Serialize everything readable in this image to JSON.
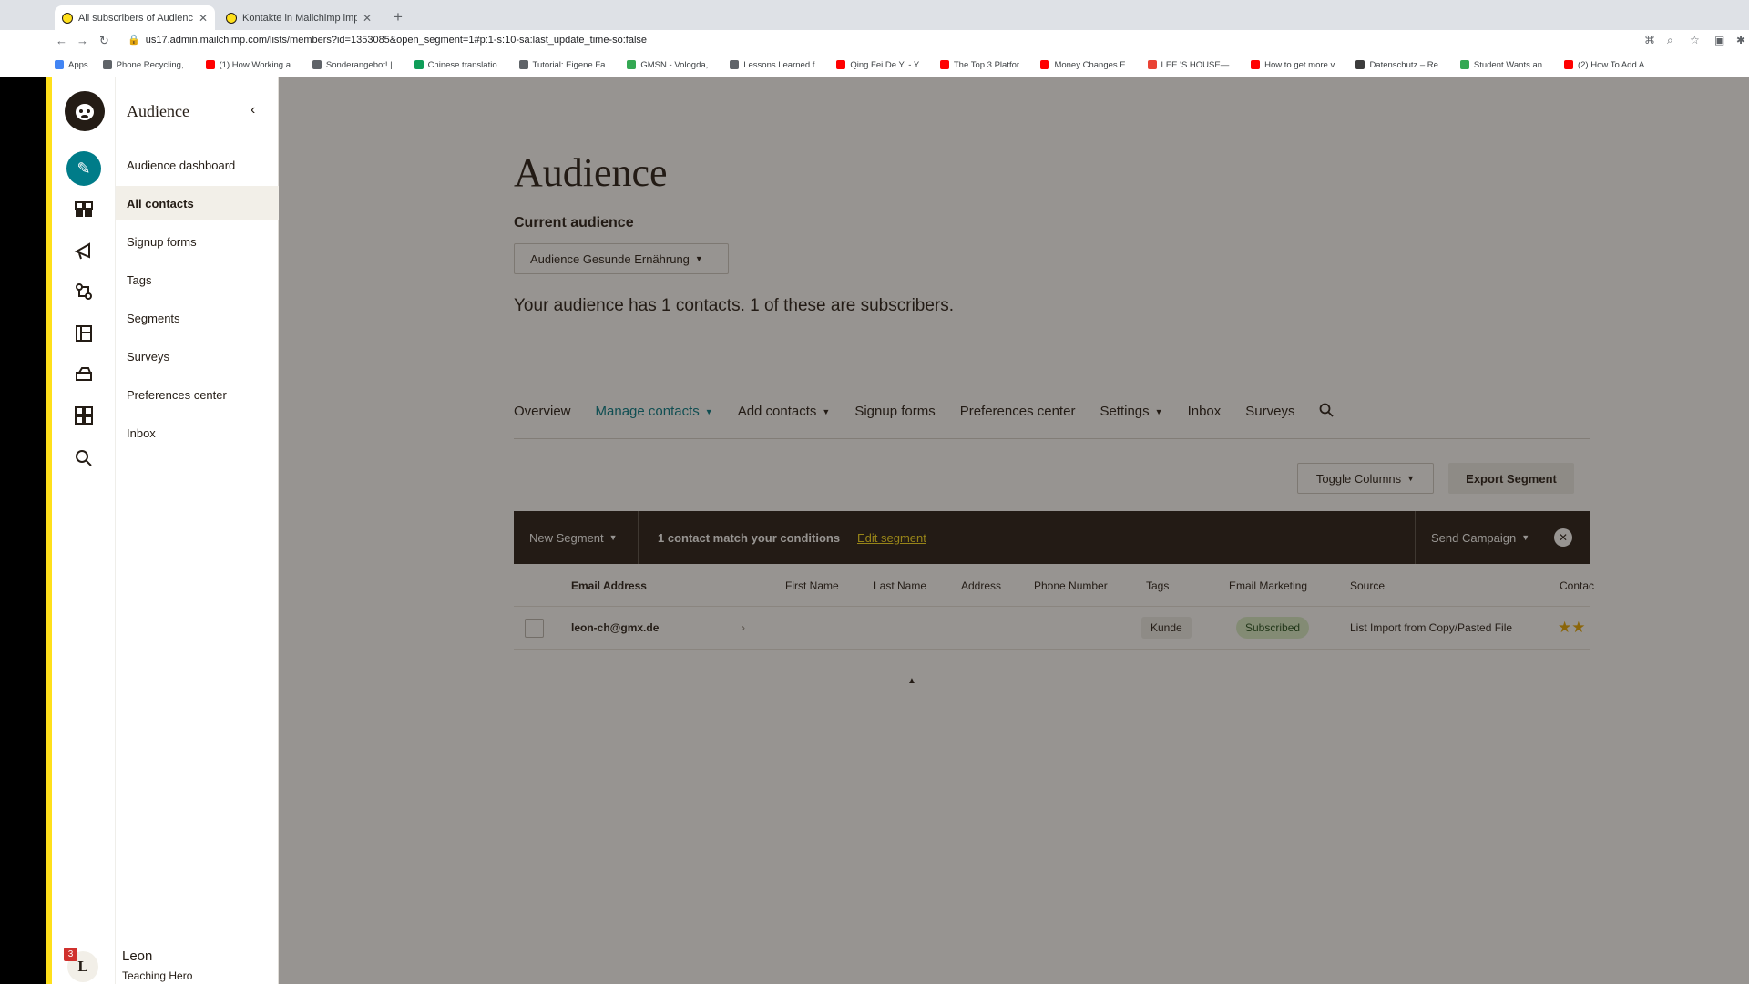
{
  "browser": {
    "tabs": [
      {
        "title": "All subscribers of Audience Ge",
        "active": true
      },
      {
        "title": "Kontakte in Mailchimp importi",
        "active": false
      }
    ],
    "new_tab": "+",
    "url": "us17.admin.mailchimp.com/lists/members?id=1353085&open_segment=1#p:1-s:10-sa:last_update_time-so:false",
    "bookmarks": [
      {
        "label": "Apps",
        "color": "#4285f4"
      },
      {
        "label": "Phone Recycling,...",
        "color": "#5f6368"
      },
      {
        "label": "(1) How Working a...",
        "color": "#ff0000"
      },
      {
        "label": "Sonderangebot! |...",
        "color": "#5f6368"
      },
      {
        "label": "Chinese translatio...",
        "color": "#0f9d58"
      },
      {
        "label": "Tutorial: Eigene Fa...",
        "color": "#5f6368"
      },
      {
        "label": "GMSN - Vologda,...",
        "color": "#34a853"
      },
      {
        "label": "Lessons Learned f...",
        "color": "#5f6368"
      },
      {
        "label": "Qing Fei De Yi - Y...",
        "color": "#ff0000"
      },
      {
        "label": "The Top 3 Platfor...",
        "color": "#ff0000"
      },
      {
        "label": "Money Changes E...",
        "color": "#ff0000"
      },
      {
        "label": "LEE 'S HOUSE—...",
        "color": "#ea4335"
      },
      {
        "label": "How to get more v...",
        "color": "#ff0000"
      },
      {
        "label": "Datenschutz – Re...",
        "color": "#3c3c3c"
      },
      {
        "label": "Student Wants an...",
        "color": "#34a853"
      },
      {
        "label": "(2) How To Add A...",
        "color": "#ff0000"
      }
    ]
  },
  "rail": {
    "icons": [
      "mailchimp-logo-icon",
      "pencil-icon",
      "contacts-icon",
      "campaigns-icon",
      "automations-icon",
      "website-icon",
      "content-icon",
      "integrations-icon",
      "search-icon"
    ],
    "notification_count": "3",
    "avatar_initial": "L"
  },
  "sidebar": {
    "title": "Audience",
    "items": [
      {
        "label": "Audience dashboard",
        "active": false
      },
      {
        "label": "All contacts",
        "active": true
      },
      {
        "label": "Signup forms",
        "active": false
      },
      {
        "label": "Tags",
        "active": false
      },
      {
        "label": "Segments",
        "active": false
      },
      {
        "label": "Surveys",
        "active": false
      },
      {
        "label": "Preferences center",
        "active": false
      },
      {
        "label": "Inbox",
        "active": false
      }
    ],
    "user_name": "Leon",
    "user_subtitle": "Teaching Hero"
  },
  "main": {
    "title": "Audience",
    "current_label": "Current audience",
    "audience_select": "Audience Gesunde Ernährung",
    "summary": "Your audience has 1 contacts. 1 of these are subscribers.",
    "tabs": [
      {
        "label": "Overview",
        "dropdown": false
      },
      {
        "label": "Manage contacts",
        "dropdown": true,
        "active": true
      },
      {
        "label": "Add contacts",
        "dropdown": true
      },
      {
        "label": "Signup forms",
        "dropdown": false
      },
      {
        "label": "Preferences center",
        "dropdown": false
      },
      {
        "label": "Settings",
        "dropdown": true
      },
      {
        "label": "Inbox",
        "dropdown": false
      },
      {
        "label": "Surveys",
        "dropdown": false
      }
    ],
    "toggle_columns": "Toggle Columns",
    "export_segment": "Export Segment",
    "segment_bar": {
      "new_segment": "New Segment",
      "match_text": "1 contact match your conditions",
      "edit_link": "Edit segment",
      "send_campaign": "Send Campaign"
    },
    "table": {
      "headers": [
        "Email Address",
        "First Name",
        "Last Name",
        "Address",
        "Phone Number",
        "Tags",
        "Email Marketing",
        "Source",
        "Contac"
      ],
      "rows": [
        {
          "email": "leon-ch@gmx.de",
          "tag": "Kunde",
          "status": "Subscribed",
          "source": "List Import from Copy/Pasted File",
          "rating": "★★"
        }
      ]
    }
  },
  "colors": {
    "accent": "#007c89",
    "brand_yellow": "#ffe01b",
    "dark": "#241c15"
  }
}
